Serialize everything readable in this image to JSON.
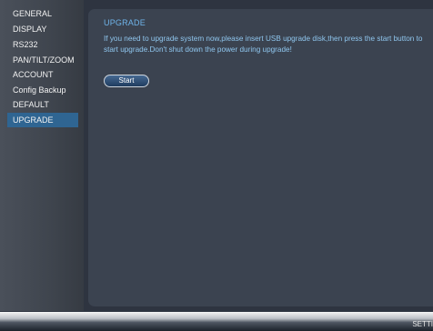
{
  "sidebar": {
    "items": [
      {
        "label": "GENERAL",
        "active": false
      },
      {
        "label": "DISPLAY",
        "active": false
      },
      {
        "label": "RS232",
        "active": false
      },
      {
        "label": "PAN/TILT/ZOOM",
        "active": false
      },
      {
        "label": "ACCOUNT",
        "active": false
      },
      {
        "label": "Config Backup",
        "active": false
      },
      {
        "label": "DEFAULT",
        "active": false
      },
      {
        "label": "UPGRADE",
        "active": true
      }
    ]
  },
  "panel": {
    "title": "UPGRADE",
    "instructions": "If you need to upgrade system now,please insert USB upgrade disk,then press the start button to start upgrade.Don't shut down the power during upgrade!",
    "start_label": "Start"
  },
  "bottom_bar": {
    "label": "SETTI"
  },
  "colors": {
    "active_item": "#2f6592",
    "title_text": "#6fb4ea",
    "body_text": "#8fc6ee",
    "panel_bg": "#3b4350"
  }
}
